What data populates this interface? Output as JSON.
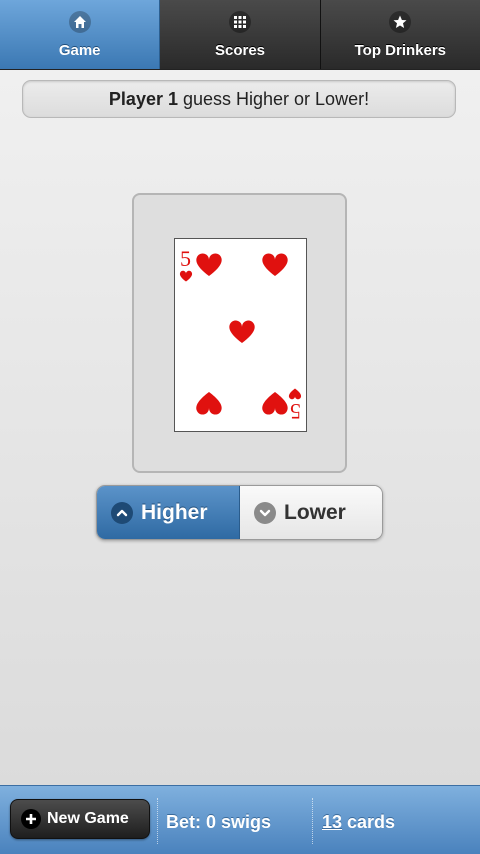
{
  "tabs": [
    {
      "label": "Game",
      "icon": "home-icon",
      "active": true
    },
    {
      "label": "Scores",
      "icon": "grid-icon",
      "active": false
    },
    {
      "label": "Top Drinkers",
      "icon": "star-icon",
      "active": false
    }
  ],
  "status": {
    "player": "Player 1",
    "message": " guess Higher or Lower!"
  },
  "card": {
    "rank": "5",
    "suit": "hearts",
    "color": "#e0110f"
  },
  "choices": {
    "higher_label": "Higher",
    "lower_label": "Lower",
    "selected": "Higher"
  },
  "footer": {
    "new_game_label": "New Game",
    "bet_text": "Bet: 0 swigs",
    "card_count": "13",
    "cards_suffix": " cards"
  },
  "colors": {
    "accent": "#3b78b3",
    "tab_dark": "#2a2a2a",
    "heart_red": "#e0110f"
  }
}
